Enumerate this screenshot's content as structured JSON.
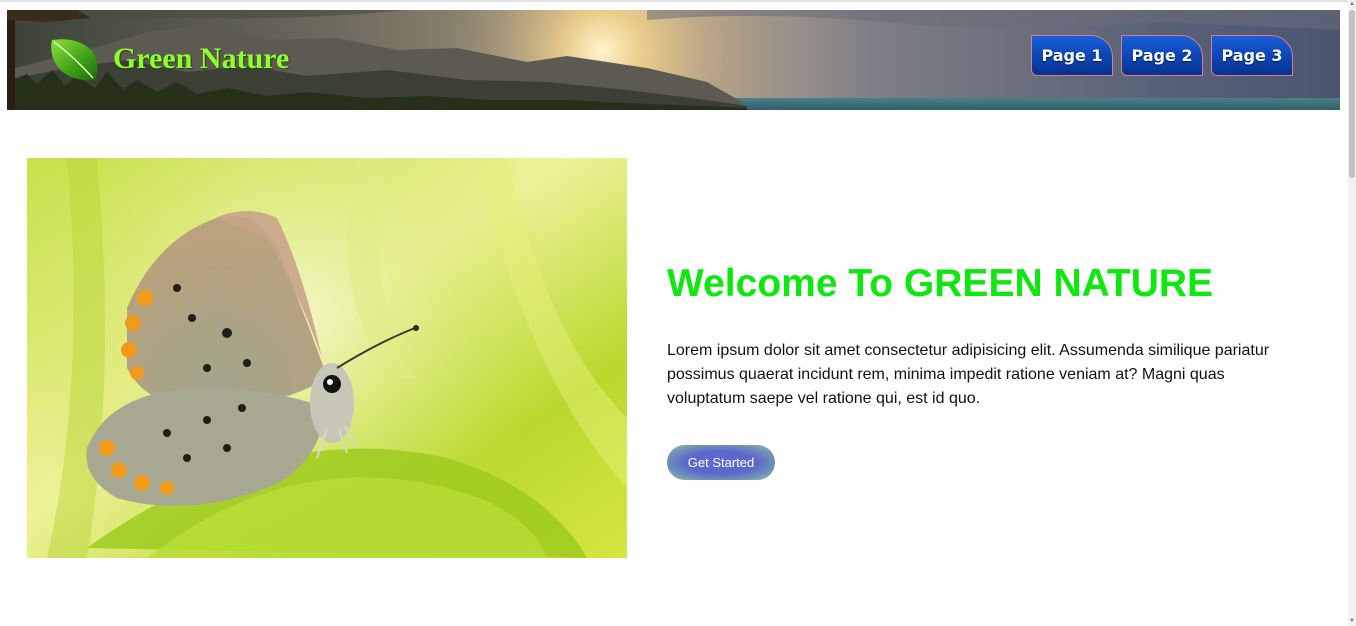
{
  "header": {
    "brand": "Green Nature",
    "nav": [
      {
        "label": "Page 1"
      },
      {
        "label": "Page 2"
      },
      {
        "label": "Page 3"
      }
    ]
  },
  "hero": {
    "title": "Welcome To GREEN NATURE",
    "body": "Lorem ipsum dolor sit amet consectetur adipisicing elit. Assumenda similique pariatur possimus quaerat incidunt rem, minima impedit ratione veniam at? Magni quas voluptatum saepe vel ratione qui, est id quo.",
    "cta_label": "Get Started"
  },
  "icons": {
    "logo": "leaf-icon",
    "hero_image": "butterfly-photo",
    "banner": "sunset-beach-photo"
  },
  "colors": {
    "brand_text": "#8fff2a",
    "title": "#0ee80e",
    "nav_button": "#0b46b8",
    "nav_border": "#e07a8a"
  }
}
